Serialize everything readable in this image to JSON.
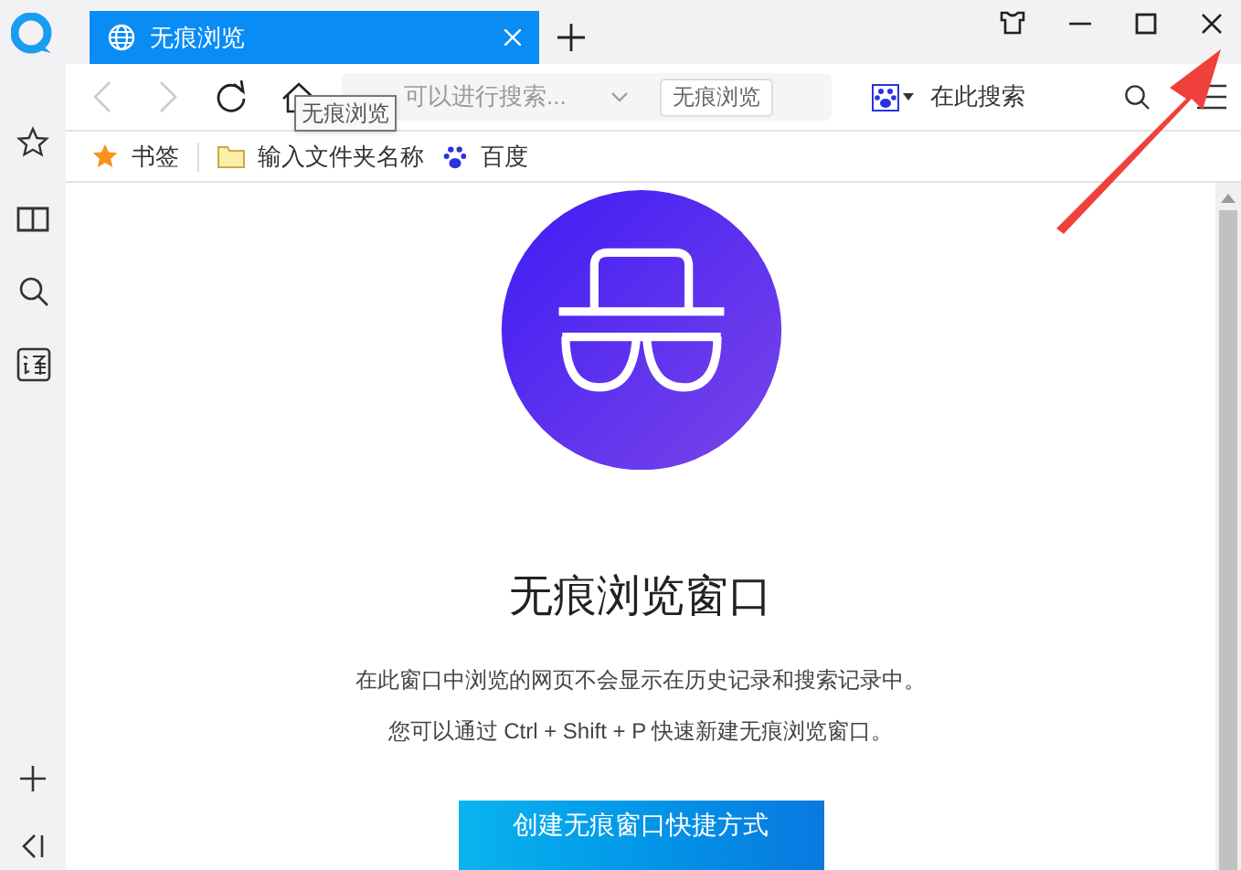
{
  "tab": {
    "title": "无痕浏览",
    "selected": true
  },
  "tooltip": "无痕浏览",
  "address": {
    "text": "可以进行搜索..."
  },
  "mode_badge": "无痕浏览",
  "search": {
    "placeholder": "在此搜索"
  },
  "bookmarks": [
    {
      "kind": "star",
      "label": "书签"
    },
    {
      "kind": "folder",
      "label": "输入文件夹名称"
    },
    {
      "kind": "paw",
      "label": "百度"
    }
  ],
  "page": {
    "title": "无痕浏览窗口",
    "lines": [
      "在此窗口中浏览的网页不会显示在历史记录和搜索记录中。",
      "您可以通过 Ctrl + Shift + P 快速新建无痕浏览窗口。"
    ],
    "button": "创建无痕窗口快捷方式"
  }
}
